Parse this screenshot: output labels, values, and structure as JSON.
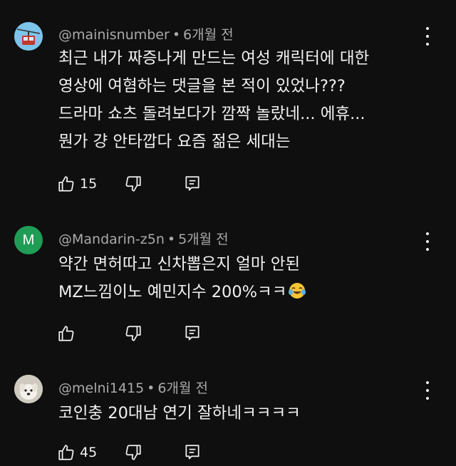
{
  "comments": [
    {
      "author": "@mainisnumber",
      "time": "6개월 전",
      "lines": [
        "최근 내가 짜증나게 만드는 여성 캐릭터에 대한",
        "영상에 여혐하는 댓글을 본 적이 있었나???",
        "드라마 쇼츠 돌려보다가 깜짝 놀랐네... 에휴...",
        "뭔가 걍 안타깝다 요즘 젊은 세대는"
      ],
      "likes": "15",
      "avatar": "cable-car"
    },
    {
      "author": "@Mandarin-z5n",
      "time": "5개월 전",
      "lines": [
        "약간 면허따고 신차뽑은지 얼마 안된",
        "MZ느낌이노 예민지수 200%ㅋㅋ"
      ],
      "emoji": "tears-of-joy",
      "likes": "",
      "avatar_letter": "M",
      "avatar_color": "#1f9d55"
    },
    {
      "author": "@melni1415",
      "time": "6개월 전",
      "lines": [
        "코인충 20대남 연기 잘하네ㅋㅋㅋㅋ"
      ],
      "likes": "45",
      "avatar": "dog-photo"
    }
  ],
  "separator": "•"
}
